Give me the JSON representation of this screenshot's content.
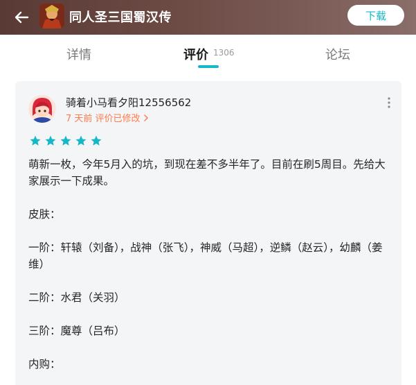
{
  "header": {
    "title": "同人圣三国蜀汉传",
    "download_label": "下载"
  },
  "tabs": {
    "detail": "详情",
    "review": "评价",
    "review_count": "1306",
    "forum": "论坛"
  },
  "review": {
    "username": "骑着小马看夕阳12556562",
    "meta": "7 天前 评价已修改",
    "rating": 5,
    "paragraphs": [
      "萌新一枚，今年5月入的坑，到现在差不多半年了。目前在刷5周目。先给大家展示一下成果。",
      "皮肤：",
      "一阶：轩辕（刘备），战神（张飞），神威（马超），逆鳞（赵云），幼麟（姜维）",
      "二阶：水君（关羽）",
      "三阶：魔尊（吕布）",
      "内购："
    ]
  },
  "colors": {
    "accent": "#16b8c8",
    "meta": "#ff7a4d",
    "card_bg": "#f4f5f7"
  }
}
